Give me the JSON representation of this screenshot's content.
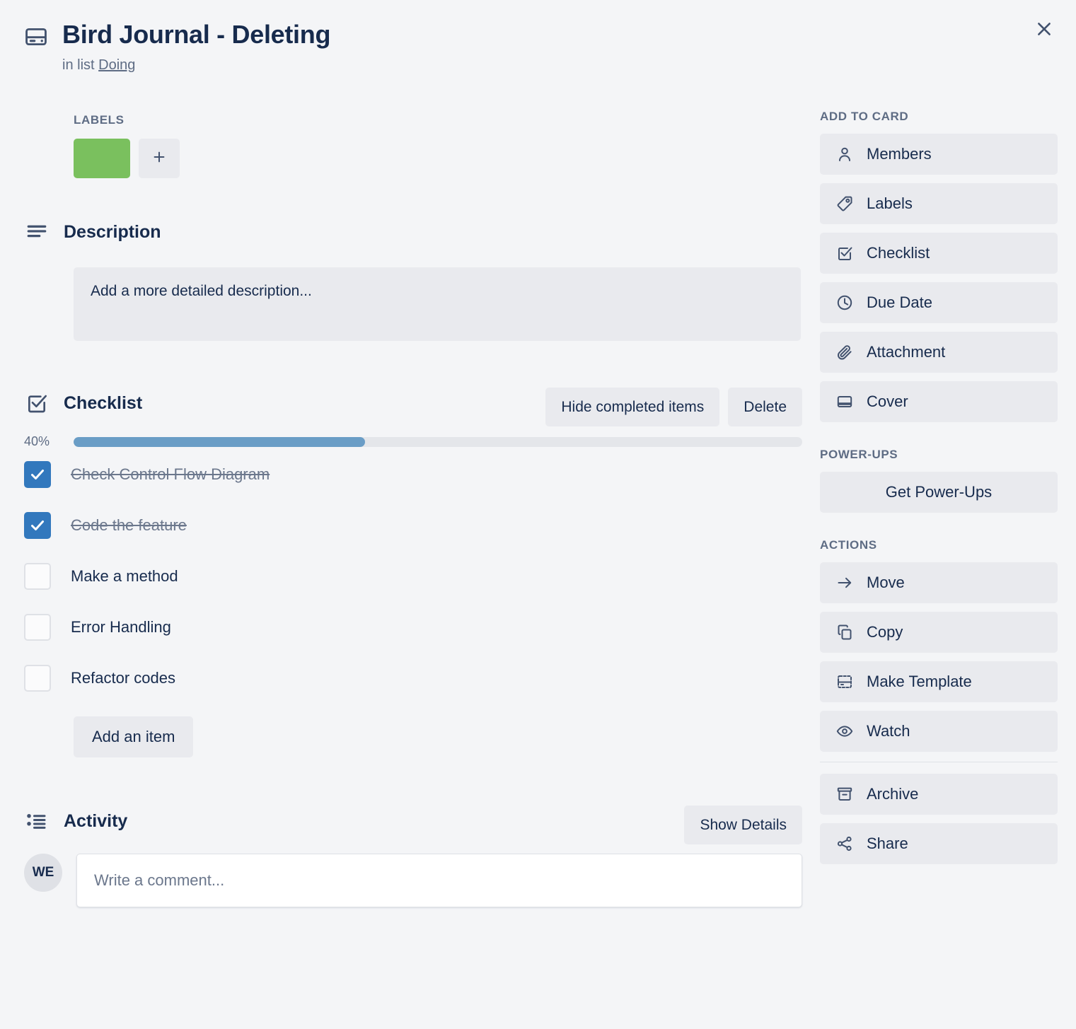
{
  "header": {
    "icon": "card-icon",
    "title": "Bird Journal - Deleting",
    "in_list_prefix": "in list",
    "list_name": "Doing",
    "close_icon": "close-icon"
  },
  "labels": {
    "heading": "LABELS",
    "chips": [
      {
        "color": "#7ac05e",
        "name": "green-label"
      }
    ],
    "add_icon": "plus-icon"
  },
  "description": {
    "icon": "description-lines-icon",
    "title": "Description",
    "placeholder": "Add a more detailed description..."
  },
  "checklist": {
    "icon": "checklist-icon",
    "title": "Checklist",
    "hide_completed_label": "Hide completed items",
    "delete_label": "Delete",
    "progress_percent_label": "40%",
    "progress_percent": 40,
    "progress_fill_color": "#6a9dc6",
    "progress_track_color": "#e4e6ea",
    "items": [
      {
        "label": "Check Control Flow Diagram",
        "checked": true
      },
      {
        "label": "Code the feature",
        "checked": true
      },
      {
        "label": "Make a method",
        "checked": false
      },
      {
        "label": "Error Handling",
        "checked": false
      },
      {
        "label": "Refactor codes",
        "checked": false
      }
    ],
    "add_item_label": "Add an item"
  },
  "activity": {
    "icon": "activity-list-icon",
    "title": "Activity",
    "show_details_label": "Show Details",
    "avatar_initials": "WE",
    "comment_placeholder": "Write a comment...",
    "comment_value": ""
  },
  "sidebar": {
    "add_to_card_heading": "ADD TO CARD",
    "add_to_card_items": [
      {
        "label": "Members",
        "icon": "person-icon"
      },
      {
        "label": "Labels",
        "icon": "tag-icon"
      },
      {
        "label": "Checklist",
        "icon": "checklist-icon"
      },
      {
        "label": "Due Date",
        "icon": "clock-icon"
      },
      {
        "label": "Attachment",
        "icon": "paperclip-icon"
      },
      {
        "label": "Cover",
        "icon": "cover-icon"
      }
    ],
    "power_ups_heading": "POWER-UPS",
    "get_power_ups_label": "Get Power-Ups",
    "actions_heading": "ACTIONS",
    "actions_items": [
      {
        "label": "Move",
        "icon": "arrow-right-icon"
      },
      {
        "label": "Copy",
        "icon": "copy-icon"
      },
      {
        "label": "Make Template",
        "icon": "template-icon"
      },
      {
        "label": "Watch",
        "icon": "eye-icon"
      }
    ],
    "actions_items_bottom": [
      {
        "label": "Archive",
        "icon": "archive-icon"
      },
      {
        "label": "Share",
        "icon": "share-icon"
      }
    ]
  }
}
